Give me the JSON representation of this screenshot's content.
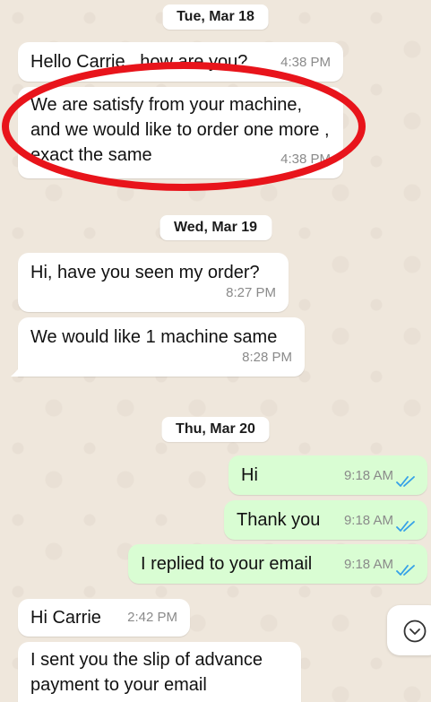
{
  "dates": [
    "Tue, Mar 18",
    "Wed, Mar 19",
    "Thu, Mar 20"
  ],
  "messages": [
    {
      "text": "Hello Carrie , how are you?",
      "time": "4:38 PM"
    },
    {
      "text": "We are satisfy from your machine, and we would like to order one more , exact the same",
      "time": "4:38 PM"
    },
    {
      "text": "Hi, have you seen my order?",
      "time": "8:27 PM"
    },
    {
      "text": "We would like 1 machine same",
      "time": "8:28 PM"
    },
    {
      "text": "Hi",
      "time": "9:18 AM"
    },
    {
      "text": "Thank you",
      "time": "9:18 AM"
    },
    {
      "text": "I replied to your email",
      "time": "9:18 AM"
    },
    {
      "text": "Hi Carrie",
      "time": "2:42 PM"
    },
    {
      "text": "I sent you the slip of advance payment to your email",
      "time": ""
    }
  ],
  "icons": {
    "read_receipt": "double-check-icon",
    "scroll_down": "chevron-down-icon"
  },
  "colors": {
    "incoming_bubble": "#ffffff",
    "outgoing_bubble": "#d9fdd3",
    "read_tick": "#34a0e8",
    "highlight_ring": "#e8141b",
    "background": "#efe7dc"
  }
}
